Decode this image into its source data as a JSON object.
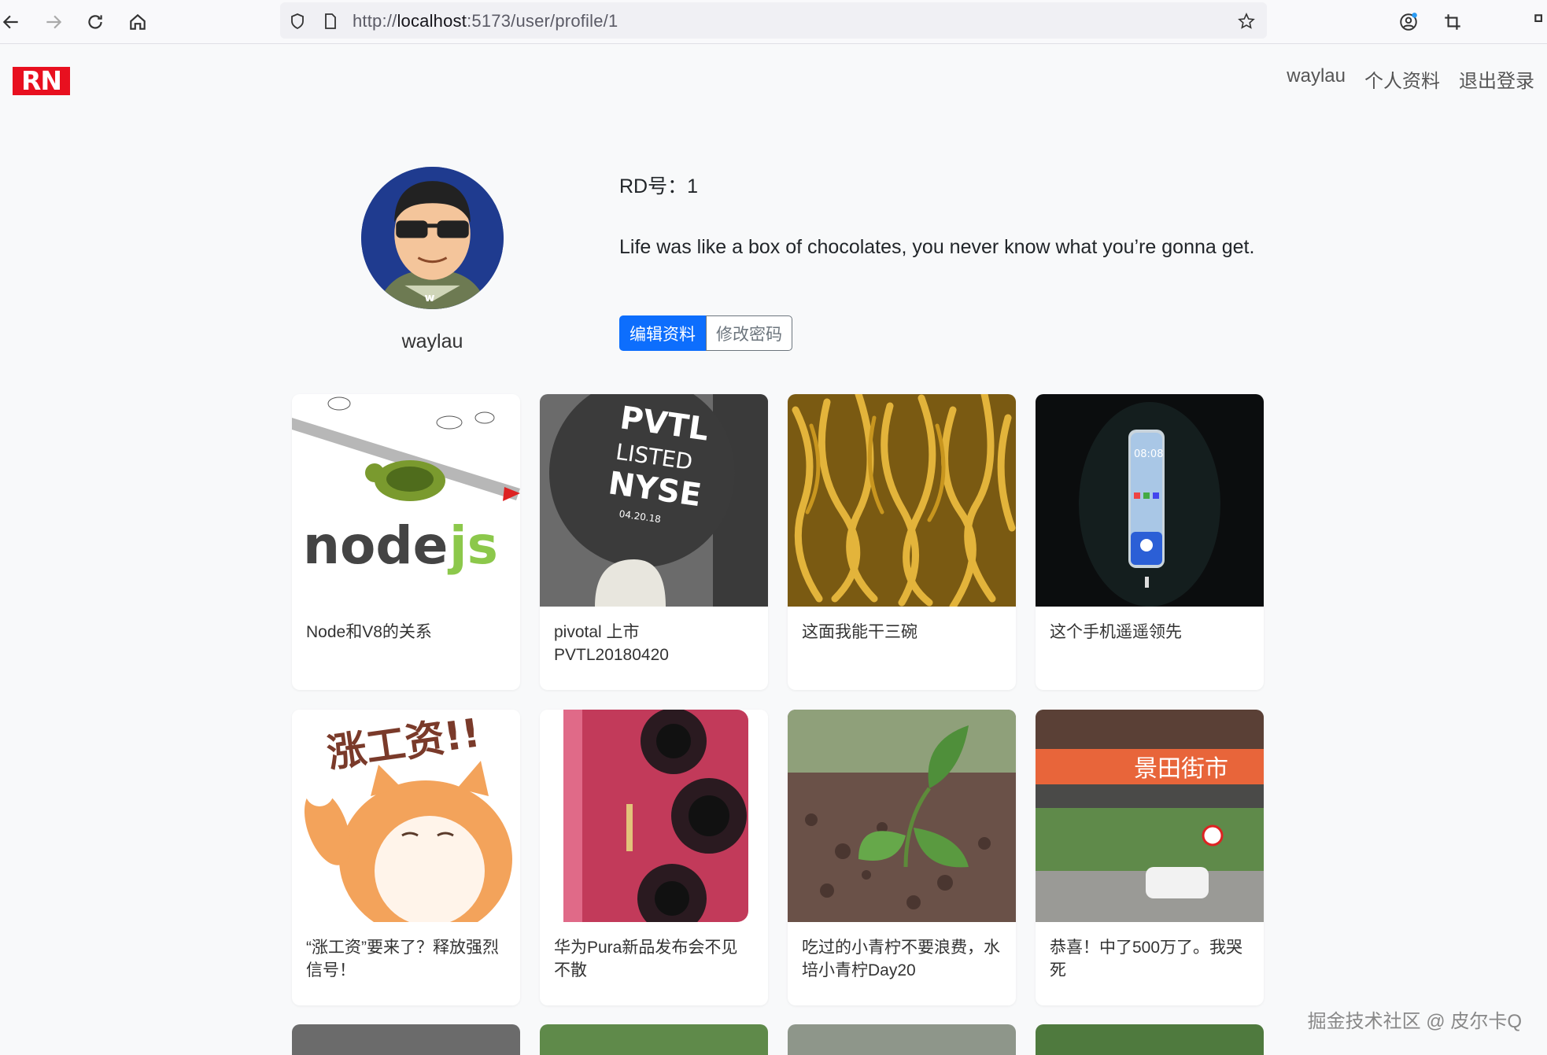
{
  "browser": {
    "url_prefix": "http://",
    "url_host": "localhost",
    "url_rest": ":5173/user/profile/1"
  },
  "navbar": {
    "logo": "RN",
    "links": [
      "waylau",
      "个人资料",
      "退出登录"
    ]
  },
  "profile": {
    "username": "waylau",
    "rd_label": "RD号：1",
    "bio": "Life was like a box of chocolates, you never know what you’re gonna get.",
    "edit_button": "编辑资料",
    "password_button": "修改密码"
  },
  "posts": [
    {
      "title": "Node和V8的关系"
    },
    {
      "title": "pivotal 上市 PVTL20180420"
    },
    {
      "title": "这面我能干三碗"
    },
    {
      "title": "这个手机遥遥领先"
    },
    {
      "title": "“涨工资”要来了？释放强烈信号！"
    },
    {
      "title": "华为Pura新品发布会不见不散"
    },
    {
      "title": "吃过的小青柠不要浪费，水培小青柠Day20"
    },
    {
      "title": "恭喜！中了500万了。我哭死"
    }
  ],
  "image_text": {
    "node_logo": "node",
    "node_js": "js",
    "pvtl": "PVTL",
    "listed": "LISTED",
    "nyse": "NYSE",
    "pvtl_date": "04.20.18",
    "phone_time": "08:08",
    "raise": "涨工资!!",
    "sign": "景田街市"
  },
  "watermark": "掘金技术社区 @ 皮尔卡Q"
}
